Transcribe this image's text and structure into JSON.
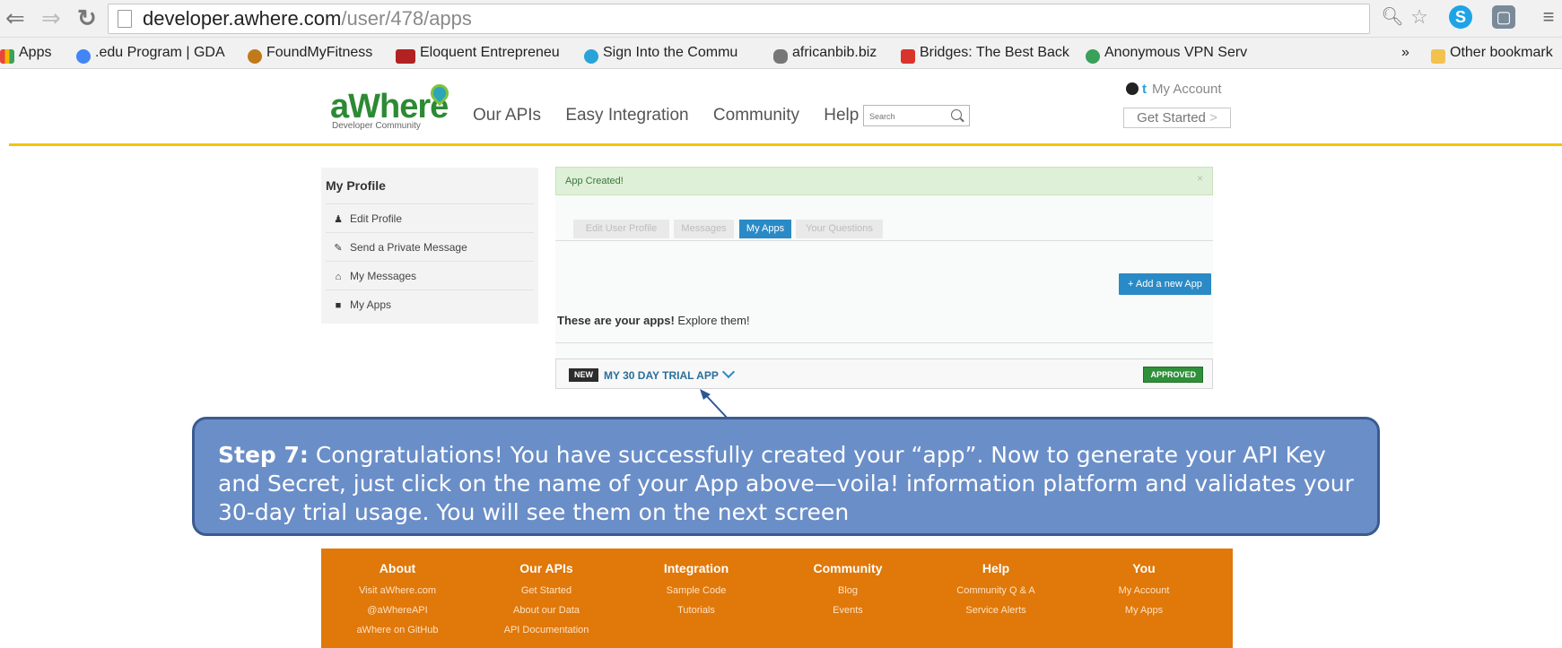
{
  "browser": {
    "url_host": "developer.awhere.com",
    "url_path": "/user/478/apps",
    "bookmarks": [
      {
        "label": "Apps",
        "icon": "apps-grid-icon",
        "color": "#e8453c"
      },
      {
        "label": ".edu Program | GDA",
        "icon": "google-icon",
        "color": "#4285f4"
      },
      {
        "label": "FoundMyFitness",
        "icon": "avocado-icon",
        "color": "#c07a1a"
      },
      {
        "label": "Eloquent Entrepreneu",
        "icon": "fth-icon",
        "color": "#b22222"
      },
      {
        "label": "Sign Into the Commu",
        "icon": "map-pin-icon",
        "color": "#2aa3d8"
      },
      {
        "label": "africanbib.biz",
        "icon": "africa-icon",
        "color": "#777777"
      },
      {
        "label": "Bridges: The Best Back",
        "icon": "calendar-icon",
        "color": "#d9342b"
      },
      {
        "label": "Anonymous VPN Serv",
        "icon": "vpn-icon",
        "color": "#3aa05a"
      }
    ],
    "overflow_label": "»",
    "other_bookmarks": "Other bookmark"
  },
  "site": {
    "logo": "aWhere",
    "logo_sub": "Developer Community",
    "nav": [
      "Our APIs",
      "Easy Integration",
      "Community",
      "Help"
    ],
    "search_placeholder": "Search",
    "my_account": "My Account",
    "get_started": "Get Started",
    "get_started_arrow": ">"
  },
  "sidebar": {
    "title": "My Profile",
    "items": [
      {
        "label": "Edit Profile",
        "icon": "user-icon"
      },
      {
        "label": "Send a Private Message",
        "icon": "pencil-icon"
      },
      {
        "label": "My Messages",
        "icon": "inbox-icon"
      },
      {
        "label": "My Apps",
        "icon": "briefcase-icon"
      }
    ]
  },
  "main": {
    "alert": "App Created!",
    "alert_close": "×",
    "tabs": [
      "Edit User Profile",
      "Messages",
      "My Apps",
      "Your Questions"
    ],
    "active_tab": "My Apps",
    "add_app": "+ Add a new App",
    "apps_heading_bold": "These are your apps!",
    "apps_heading_rest": " Explore them!",
    "app": {
      "badge": "NEW",
      "name": "MY 30 DAY TRIAL APP",
      "status": "APPROVED"
    }
  },
  "callout": {
    "step": "Step 7:",
    "text": "  Congratulations!  You have successfully created your “app”.  Now to generate your API Key and Secret, just click on the name of your App above—voila! information platform and validates your 30-day trial usage.  You will see them on the next screen"
  },
  "footer": {
    "columns": [
      {
        "head": "About",
        "links": [
          "Visit aWhere.com",
          "@aWhereAPI",
          "aWhere on GitHub"
        ]
      },
      {
        "head": "Our APIs",
        "links": [
          "Get Started",
          "About our Data",
          "API Documentation"
        ]
      },
      {
        "head": "Integration",
        "links": [
          "Sample Code",
          "Tutorials"
        ]
      },
      {
        "head": "Community",
        "links": [
          "Blog",
          "Events"
        ]
      },
      {
        "head": "Help",
        "links": [
          "Community Q & A",
          "Service Alerts"
        ]
      },
      {
        "head": "You",
        "links": [
          "My Account",
          "My Apps"
        ]
      }
    ]
  },
  "colors": {
    "brand_green": "#2d8a34",
    "accent_yellow": "#f5c400",
    "primary_blue": "#2a8ac6",
    "footer_orange": "#e0780a",
    "callout_blue": "#6a8ec8"
  }
}
